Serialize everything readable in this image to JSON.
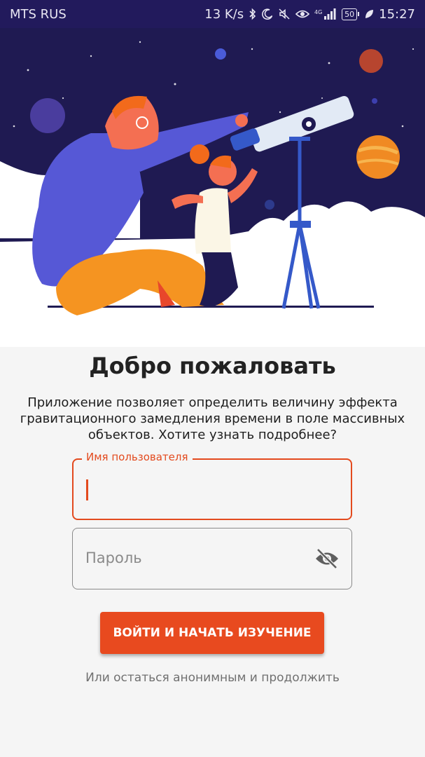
{
  "status_bar": {
    "carrier": "MTS RUS",
    "speed": "13 K/s",
    "network": "4G",
    "battery": "50",
    "time": "15:27"
  },
  "hero": {
    "illustration": "father-and-child-telescope-space"
  },
  "main": {
    "title": "Добро пожаловать",
    "description": "Приложение позволяет определить величину эффекта гравитационного замедления времени в поле массивных объектов. Хотите узнать подробнее?"
  },
  "form": {
    "username": {
      "label": "Имя пользователя",
      "value": "",
      "focused": true
    },
    "password": {
      "placeholder": "Пароль",
      "value": "",
      "visibility_icon": "eye-off-icon"
    },
    "login_button": "ВОЙТИ И НАЧАТЬ ИЗУЧЕНИЕ",
    "anonymous_link": "Или остаться анонимным и продолжить"
  },
  "colors": {
    "accent": "#e84a1f",
    "status_bar": "#221a5c",
    "background": "#f5f5f5",
    "hero_sky": "#1f1a52"
  }
}
